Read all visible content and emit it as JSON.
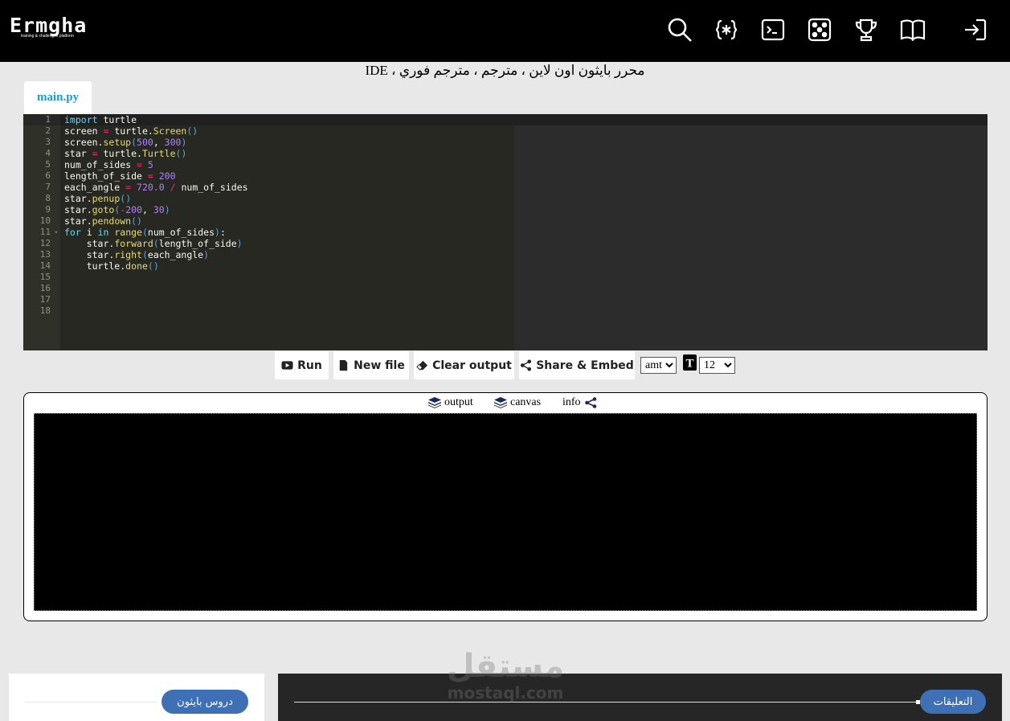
{
  "header": {
    "logo_text": "Ermgha",
    "logo_subtitle": "training & challenges platform",
    "icons": [
      "search-icon",
      "code-braces-icon",
      "terminal-icon",
      "dice-icon",
      "trophy-icon",
      "book-icon",
      "login-icon"
    ]
  },
  "page": {
    "title": "محرر بايثون اون لاين ، مترجم ، مترجم فوري ، IDE"
  },
  "editor": {
    "tab_label": "main.py",
    "line_numbers": [
      "1",
      "2",
      "3",
      "4",
      "5",
      "6",
      "7",
      "8",
      "9",
      "10",
      "11",
      "12",
      "13",
      "14",
      "15",
      "16",
      "17",
      "18"
    ],
    "code_lines": [
      "import turtle",
      "screen = turtle.Screen()",
      "screen.setup(500, 300)",
      "star = turtle.Turtle()",
      "num_of_sides = 5",
      "length_of_side = 200",
      "each_angle = 720.0 / num_of_sides",
      "star.penup()",
      "star.goto(-200, 30)",
      "star.pendown()",
      "for i in range(num_of_sides):",
      "    star.forward(length_of_side)",
      "    star.right(each_angle)",
      "    turtle.done()",
      "",
      "",
      "",
      ""
    ]
  },
  "toolbar": {
    "run_label": "Run",
    "new_file_label": "New file",
    "clear_output_label": "Clear output",
    "share_label": "Share & Embed",
    "theme_select_value": "amt",
    "font_size_value": "12"
  },
  "output": {
    "tabs": [
      {
        "label": "output",
        "icon": "layers-icon"
      },
      {
        "label": "canvas",
        "icon": "layers-icon"
      },
      {
        "label": "info",
        "icon": "share-icon"
      }
    ]
  },
  "footer": {
    "tutorials_button": "دروس بايثون",
    "comments_button": "التعليقات",
    "watermark_arabic": "مستقل",
    "watermark_latin": "mostaql.com"
  },
  "colors": {
    "accent": "#1b9bd1",
    "pill": "#3f6fb5",
    "editor_bg": "#272822"
  }
}
